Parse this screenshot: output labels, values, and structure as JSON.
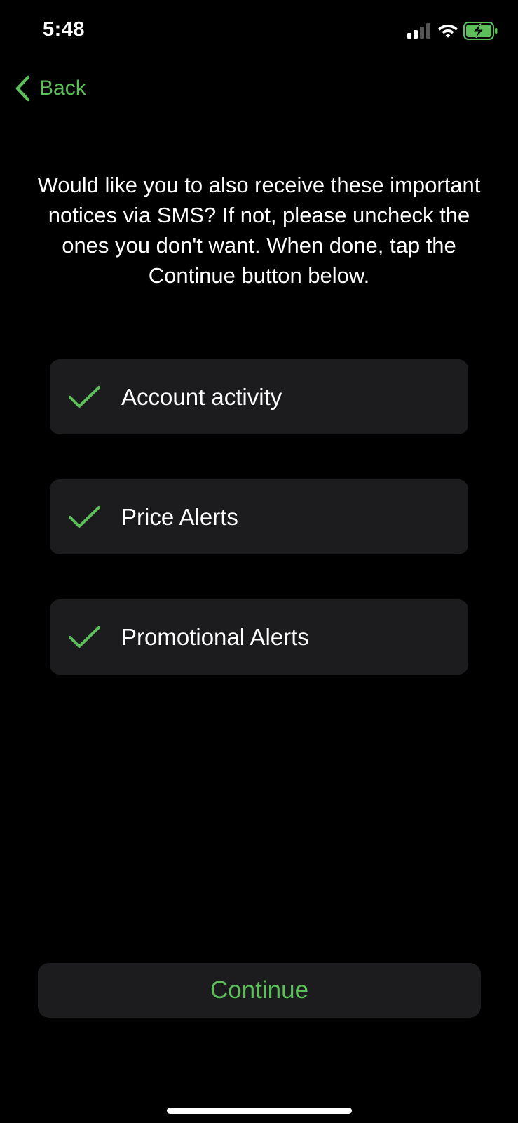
{
  "status_bar": {
    "time": "5:48",
    "signal_icon": "cellular-signal-icon",
    "wifi_icon": "wifi-icon",
    "battery_icon": "battery-charging-icon"
  },
  "nav": {
    "back_label": "Back",
    "back_icon": "chevron-left-icon"
  },
  "instructions": "Would like you to also receive these important notices via SMS? If not, please uncheck the ones you don't want. When done, tap the Continue button below.",
  "options": [
    {
      "label": "Account activity",
      "checked": true
    },
    {
      "label": "Price Alerts",
      "checked": true
    },
    {
      "label": "Promotional Alerts",
      "checked": true
    }
  ],
  "continue_label": "Continue",
  "colors": {
    "accent": "#5cbf5a",
    "background": "#000000",
    "card": "#1c1c1e",
    "text": "#ffffff"
  }
}
